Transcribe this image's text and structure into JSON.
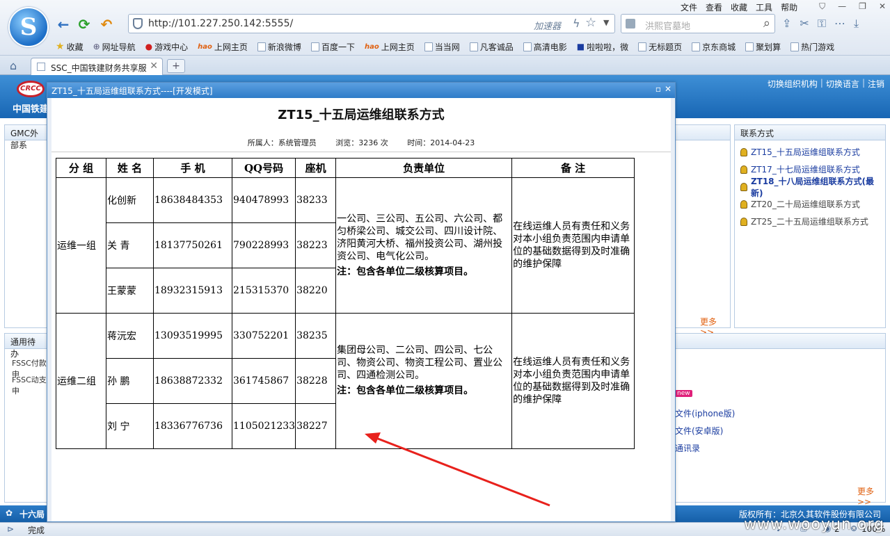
{
  "browser": {
    "url": "http://101.227.250.142:5555/",
    "accelerator_label": "加速器",
    "search_placeholder": "洪熙官墓地",
    "menu": [
      "文件",
      "查看",
      "收藏",
      "工具",
      "帮助"
    ],
    "bookmarks": [
      "收藏",
      "网址导航",
      "游戏中心",
      "上网主页",
      "新浪微博",
      "百度一下",
      "上网主页",
      "当当网",
      "凡客诚品",
      "高清电影",
      "啦啦啦，微",
      "无标题页",
      "京东商城",
      "聚划算",
      "热门游戏"
    ],
    "tab_title": "SSC_中国铁建财务共享服",
    "status_text": "完成",
    "zoom": "100%",
    "notif_count": "2"
  },
  "app": {
    "logo_text": "CRCC",
    "name": "中国铁建",
    "header_links": [
      "切换组织机构",
      "切换语言",
      "注销"
    ],
    "left_panel_title": "GMC外部系",
    "left_panel2_title": "通用待办",
    "left_items": [
      "FSSC付款申",
      "FSSC动支申"
    ],
    "contacts_panel_title": "联系方式",
    "contacts": [
      {
        "label": "ZT15_十五局运维组联系方式",
        "bold": false
      },
      {
        "label": "ZT17_十七局运维组联系方式",
        "bold": false
      },
      {
        "label": "ZT18_十八局运维组联系方式(最新)",
        "bold": true
      },
      {
        "label": "ZT20_二十局运维组联系方式",
        "bold": false
      },
      {
        "label": "ZT25_二十五局运维组联系方式",
        "bold": false
      }
    ],
    "more_label": "更多>>",
    "new_badge": "new",
    "side_links": [
      "文件(iphone版)",
      "文件(安卓版)",
      "通讯录"
    ],
    "footer_left": "十六局",
    "footer_right": "版权所有：北京久其软件股份有限公司"
  },
  "modal": {
    "window_title": "ZT15_十五局运维组联系方式----[开发模式]",
    "doc_title": "ZT15_十五局运维组联系方式",
    "owner_label": "所属人：系统管理员",
    "views_label": "浏览：3236 次",
    "date_label": "时间：2014-04-23",
    "table": {
      "headers": [
        "分 组",
        "姓 名",
        "手 机",
        "QQ号码",
        "座机",
        "负责单位",
        "备 注"
      ],
      "groups": [
        {
          "name": "运维一组",
          "members": [
            {
              "name": "化创新",
              "phone": "18638484353",
              "qq": "940478993",
              "ext": "38233"
            },
            {
              "name": "关 青",
              "phone": "18137750261",
              "qq": "790228993",
              "ext": "38223"
            },
            {
              "name": "王蒙蒙",
              "phone": "18932315913",
              "qq": "215315370",
              "ext": "38220"
            }
          ],
          "units": "一公司、三公司、五公司、六公司、都匀桥梁公司、城交公司、四川设计院、济阳黄河大桥、福州投资公司、湖州投资公司、电气化公司。",
          "units_note": "注：包含各单位二级核算项目。",
          "remark": "在线运维人员有责任和义务对本小组负责范围内申请单位的基础数据得到及时准确的维护保障"
        },
        {
          "name": "运维二组",
          "members": [
            {
              "name": "蒋沅宏",
              "phone": "13093519995",
              "qq": "330752201",
              "ext": "38235"
            },
            {
              "name": "孙 鹏",
              "phone": "18638872332",
              "qq": "361745867",
              "ext": "38228"
            },
            {
              "name": "刘 宁",
              "phone": "18336776736",
              "qq": "1105021233",
              "ext": "38227"
            }
          ],
          "units": "集团母公司、二公司、四公司、七公司、物资公司、物资工程公司、置业公司、四通检测公司。",
          "units_note": "注：包含各单位二级核算项目。",
          "remark": "在线运维人员有责任和义务对本小组负责范围内申请单位的基础数据得到及时准确的维护保障"
        }
      ]
    }
  },
  "watermark": "www.wooyun.org",
  "colors": {
    "arrow": "#e8211c",
    "header_blue": "#1866b4",
    "link_blue": "#1a3ca0"
  }
}
